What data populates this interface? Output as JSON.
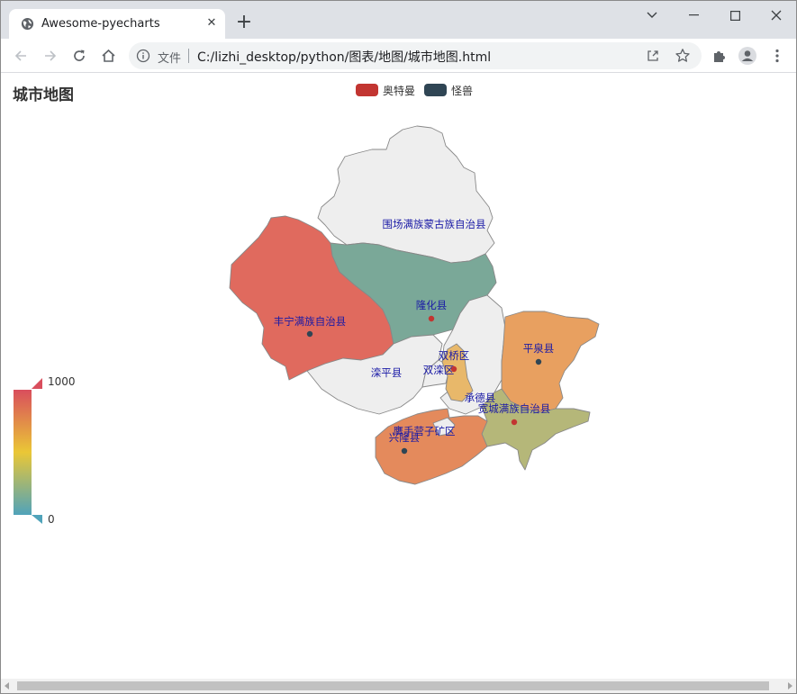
{
  "browser": {
    "tab_title": "Awesome-pyecharts",
    "omnibox_label": "文件",
    "url": "C:/lizhi_desktop/python/图表/地图/城市地图.html"
  },
  "chart": {
    "title": "城市地图",
    "legend": [
      {
        "name": "奥特曼",
        "color": "#c23531"
      },
      {
        "name": "怪兽",
        "color": "#2f4554"
      }
    ],
    "visual_map": {
      "max": "1000",
      "min": "0",
      "colors": [
        "#d94e5d",
        "#eac736",
        "#50a3ba"
      ]
    }
  },
  "regions": [
    {
      "name": "围场满族蒙古族自治县",
      "color": "#eeeeee"
    },
    {
      "name": "丰宁满族自治县",
      "color": "#e06a5e"
    },
    {
      "name": "隆化县",
      "color": "#7aa898"
    },
    {
      "name": "平泉县",
      "color": "#e8a060"
    },
    {
      "name": "滦平县",
      "color": "#eeeeee"
    },
    {
      "name": "双桥区",
      "color": "#e8b86a"
    },
    {
      "name": "双滦区",
      "color": "#eeeeee"
    },
    {
      "name": "承德县",
      "color": "#eeeeee"
    },
    {
      "name": "宽城满族自治县",
      "color": "#b5b779"
    },
    {
      "name": "兴隆县",
      "color": "#e48a5c"
    },
    {
      "name": "鹰手营子矿区",
      "color": "#eeeeee"
    }
  ]
}
